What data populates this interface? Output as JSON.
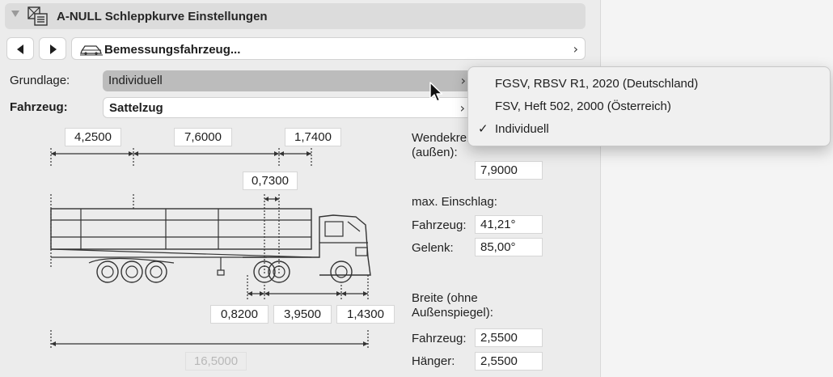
{
  "header": {
    "title": "A-NULL Schleppkurve Einstellungen"
  },
  "nav": {
    "field_label": "Bemessungsfahrzeug..."
  },
  "form": {
    "grundlage_label": "Grundlage:",
    "grundlage_value": "Individuell",
    "fahrzeug_label": "Fahrzeug:",
    "fahrzeug_value": "Sattelzug"
  },
  "dimensions": {
    "top": [
      "4,2500",
      "7,6000",
      "1,7400"
    ],
    "mid": "0,7300",
    "bottom": [
      "0,8200",
      "3,9500",
      "1,4300"
    ],
    "total": "16,5000"
  },
  "details": {
    "wendekreis_label": "Wendekreis\n(außen):",
    "wendekreis_value": "7,9000",
    "einschlag_label": "max. Einschlag:",
    "einschlag_fahrzeug_label": "Fahrzeug:",
    "einschlag_fahrzeug_value": "41,21°",
    "gelenk_label": "Gelenk:",
    "gelenk_value": "85,00°",
    "breite_label": "Breite (ohne\nAußenspiegel):",
    "breite_fahrzeug_label": "Fahrzeug:",
    "breite_fahrzeug_value": "2,5500",
    "haenger_label": "Hänger:",
    "haenger_value": "2,5500"
  },
  "menu": {
    "items": [
      {
        "label": "FGSV, RBSV R1, 2020 (Deutschland)",
        "checked": false
      },
      {
        "label": "FSV, Heft 502, 2000 (Österreich)",
        "checked": false
      },
      {
        "label": "Individuell",
        "checked": true
      }
    ],
    "check_glyph": "✓"
  },
  "icons": {
    "header": "settings-list-icon",
    "nav_field": "car-icon",
    "prev": "triangle-left-icon",
    "next": "triangle-right-icon",
    "chevron": "chevron-right-icon"
  }
}
